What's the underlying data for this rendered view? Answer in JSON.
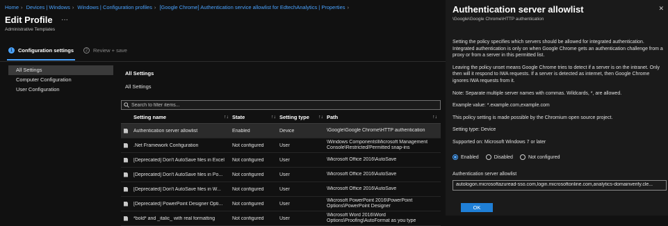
{
  "breadcrumb": [
    "Home",
    "Devices | Windows",
    "Windows | Configuration profiles",
    "[Google Chrome] Authentication service allowlist for EdtechAnalytics | Properties"
  ],
  "page": {
    "title": "Edit Profile",
    "more": "···",
    "subtitle": "Administrative Templates"
  },
  "steps": [
    {
      "num": "1",
      "label": "Configuration settings"
    },
    {
      "num": "2",
      "label": "Review + save"
    }
  ],
  "nav": [
    "All Settings",
    "Computer Configuration",
    "User Configuration"
  ],
  "section": {
    "title": "All Settings",
    "subtitle": "All Settings"
  },
  "filter": {
    "placeholder": "Search to filter items..."
  },
  "table": {
    "headers": [
      "Setting name",
      "State",
      "Setting type",
      "Path"
    ],
    "sort_glyph": "↑↓",
    "rows": [
      {
        "name": "Authentication server allowlist",
        "state": "Enabled",
        "type": "Device",
        "path": "\\Google\\Google Chrome\\HTTP authentication"
      },
      {
        "name": ".Net Framework Configuration",
        "state": "Not configured",
        "type": "User",
        "path": "\\Windows Components\\Microsoft Management Console\\Restricted/Permitted snap-ins"
      },
      {
        "name": "[Deprecated] Don't AutoSave files in Excel",
        "state": "Not configured",
        "type": "User",
        "path": "\\Microsoft Office 2016\\AutoSave"
      },
      {
        "name": "[Deprecated] Don't AutoSave files in Po...",
        "state": "Not configured",
        "type": "User",
        "path": "\\Microsoft Office 2016\\AutoSave"
      },
      {
        "name": "[Deprecated] Don't AutoSave files in W...",
        "state": "Not configured",
        "type": "User",
        "path": "\\Microsoft Office 2016\\AutoSave"
      },
      {
        "name": "[Deprecated] PowerPoint Designer Opti...",
        "state": "Not configured",
        "type": "User",
        "path": "\\Microsoft PowerPoint 2016\\PowerPoint Options\\PowerPoint Designer"
      },
      {
        "name": "*bold* and _italic_ with real formatting",
        "state": "Not configured",
        "type": "User",
        "path": "\\Microsoft Word 2016\\Word Options\\Proofing\\AutoFormat as you type"
      }
    ]
  },
  "panel": {
    "title": "Authentication server allowlist",
    "close": "✕",
    "path": "\\Google\\Google Chrome\\HTTP authentication",
    "paragraphs": [
      "Setting the policy specifies which servers should be allowed for integrated authentication. Integrated authentication is only on when Google Chrome gets an authentication challenge from a proxy or from a server in this permitted list.",
      "Leaving the policy unset means Google Chrome tries to detect if a server is on the intranet. Only then will it respond to IWA requests. If a server is detected as internet, then Google Chrome ignores IWA requests from it.",
      "Note: Separate multiple server names with commas. Wildcards, *, are allowed.",
      "Example value: *.example.com,example.com",
      "This policy setting is made possible by the Chromium open source project.",
      "Setting type: Device",
      "Supported on: Microsoft Windows 7 or later"
    ],
    "radios": [
      "Enabled",
      "Disabled",
      "Not configured"
    ],
    "selected_radio": "Enabled",
    "field_label": "Authentication server allowlist",
    "field_value": "autologon.microsoftazuread-sso.com,login.microsoftonline.com,analytics-domainverify.cle...",
    "ok_label": "OK"
  },
  "colors": {
    "accent": "#4aa3ff",
    "background": "#111111",
    "panel": "#1a1a1a"
  }
}
